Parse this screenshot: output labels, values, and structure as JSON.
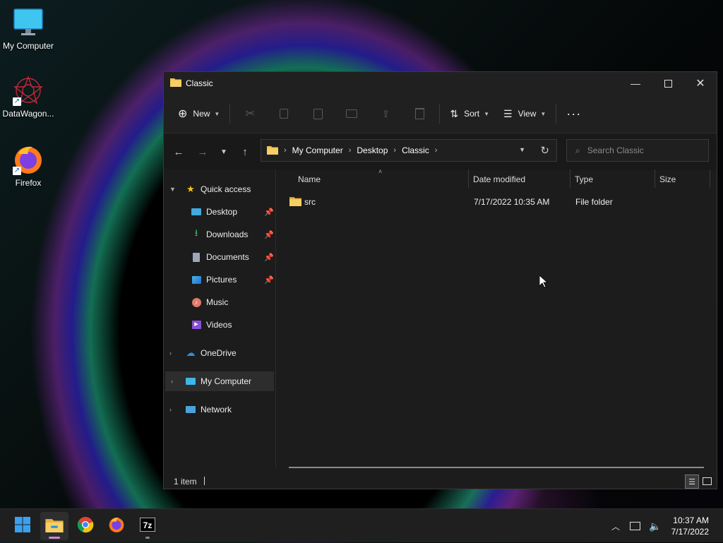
{
  "desktop": {
    "icons": [
      {
        "label": "My Computer"
      },
      {
        "label": "DataWagon..."
      },
      {
        "label": "Firefox"
      }
    ]
  },
  "window": {
    "title": "Classic",
    "toolbar": {
      "new_label": "New",
      "sort_label": "Sort",
      "view_label": "View",
      "more_label": "···"
    },
    "address": {
      "crumbs": [
        "My Computer",
        "Desktop",
        "Classic"
      ]
    },
    "search": {
      "placeholder": "Search Classic"
    },
    "nav": {
      "quick_access": "Quick access",
      "items": [
        "Desktop",
        "Downloads",
        "Documents",
        "Pictures",
        "Music",
        "Videos"
      ],
      "onedrive": "OneDrive",
      "my_computer": "My Computer",
      "network": "Network"
    },
    "columns": {
      "name": "Name",
      "date": "Date modified",
      "type": "Type",
      "size": "Size"
    },
    "files": [
      {
        "name": "src",
        "date": "7/17/2022 10:35 AM",
        "type": "File folder",
        "size": ""
      }
    ],
    "status": "1 item"
  },
  "taskbar": {
    "time": "10:37 AM",
    "date": "7/17/2022"
  },
  "colors": {
    "accent": "#0078d4",
    "folder": "#f2c14e",
    "window_bg": "#1c1c1c"
  }
}
